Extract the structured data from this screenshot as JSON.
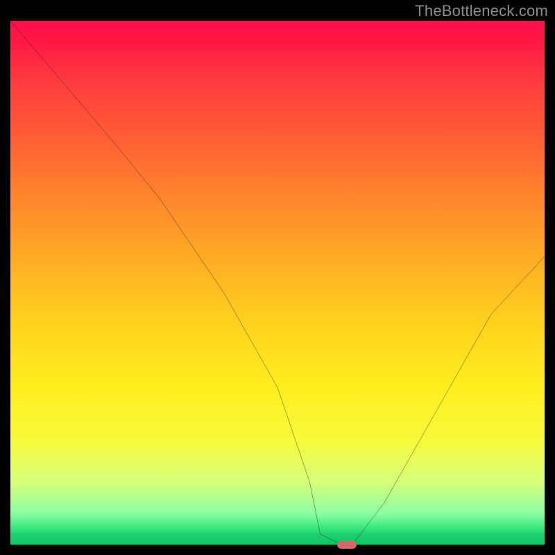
{
  "watermark": "TheBottleneck.com",
  "chart_data": {
    "type": "line",
    "title": "",
    "xlabel": "",
    "ylabel": "",
    "xlim": [
      0,
      100
    ],
    "ylim": [
      0,
      100
    ],
    "x": [
      0,
      10,
      20,
      28,
      40,
      50,
      56,
      58,
      62,
      64,
      70,
      80,
      90,
      100
    ],
    "values": [
      100,
      88,
      76,
      66,
      48,
      30,
      12,
      2,
      0,
      0,
      8,
      26,
      44,
      55
    ],
    "minimum_x": 63,
    "marker": {
      "x": 63,
      "y": 0,
      "color": "#d06a6a"
    },
    "background": "rainbow-gradient"
  }
}
